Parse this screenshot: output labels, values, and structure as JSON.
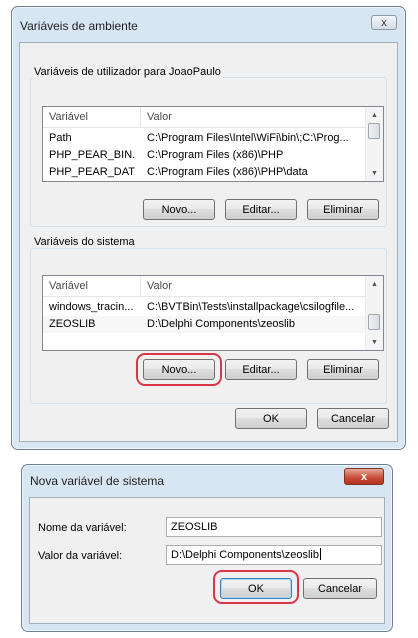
{
  "window_env": {
    "title": "Variáveis de ambiente",
    "close_label": "x",
    "user_group": {
      "label": "Variáveis de utilizador para JoaoPaulo",
      "columns": [
        "Variável",
        "Valor"
      ],
      "rows": [
        {
          "name": "Path",
          "value": "C:\\Program Files\\Intel\\WiFi\\bin\\;C:\\Prog..."
        },
        {
          "name": "PHP_PEAR_BIN...",
          "value": "C:\\Program Files (x86)\\PHP"
        },
        {
          "name": "PHP_PEAR_DAT...",
          "value": "C:\\Program Files (x86)\\PHP\\data"
        }
      ],
      "buttons": {
        "new": "Novo...",
        "edit": "Editar...",
        "delete": "Eliminar"
      }
    },
    "system_group": {
      "label": "Variáveis do sistema",
      "columns": [
        "Variável",
        "Valor"
      ],
      "rows": [
        {
          "name": "windows_tracin...",
          "value": "C:\\BVTBin\\Tests\\installpackage\\csilogfile..."
        },
        {
          "name": "ZEOSLIB",
          "value": "D:\\Delphi Components\\zeoslib"
        }
      ],
      "buttons": {
        "new": "Novo...",
        "edit": "Editar...",
        "delete": "Eliminar"
      }
    },
    "footer": {
      "ok": "OK",
      "cancel": "Cancelar"
    }
  },
  "window_new_var": {
    "title": "Nova variável de sistema",
    "close_label": "x",
    "name_label": "Nome da variável:",
    "name_value": "ZEOSLIB",
    "value_label": "Valor da variável:",
    "value_value": "D:\\Delphi Components\\zeoslib",
    "ok": "OK",
    "cancel": "Cancelar"
  },
  "colors": {
    "highlight": "#d9364a",
    "title_bar": "#d8e6f4"
  },
  "icons": {
    "close": "close-icon",
    "scroll_up": "scroll-up-arrow-icon",
    "scroll_down": "scroll-down-arrow-icon"
  }
}
